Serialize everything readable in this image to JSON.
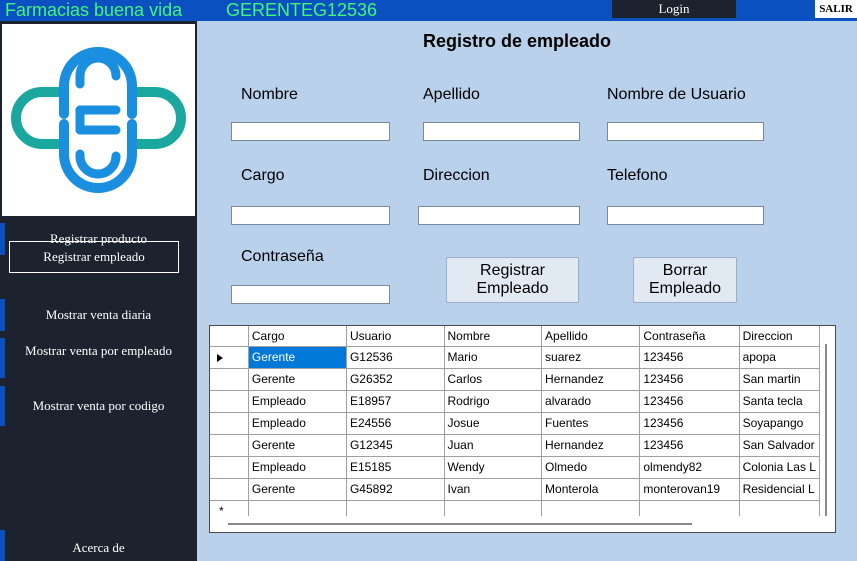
{
  "header": {
    "app_title": "Farmacias buena vida",
    "user_code": "GERENTEG12536",
    "login_label": "Login",
    "exit_label": "SALIR"
  },
  "sidebar": {
    "items": [
      {
        "label": "Registrar producto"
      },
      {
        "label": "Registrar empleado"
      },
      {
        "label": "Mostrar venta diaria"
      },
      {
        "label": "Mostrar venta por empleado"
      },
      {
        "label": "Mostrar venta por codigo"
      },
      {
        "label": "Acerca de"
      }
    ],
    "colors": {
      "logo_blue": "#1a8fe0",
      "logo_teal": "#1aa7a0"
    }
  },
  "form": {
    "title": "Registro de empleado",
    "labels": {
      "nombre": "Nombre",
      "apellido": "Apellido",
      "usuario": "Nombre de Usuario",
      "cargo": "Cargo",
      "direccion": "Direccion",
      "telefono": "Telefono",
      "contrasena": "Contraseña"
    },
    "values": {
      "nombre": "",
      "apellido": "",
      "usuario": "",
      "cargo": "",
      "direccion": "",
      "telefono": "",
      "contrasena": ""
    },
    "register_btn": {
      "line1": "Registrar",
      "line2": "Empleado"
    },
    "delete_btn": {
      "line1": "Borrar",
      "line2": "Empleado"
    }
  },
  "grid": {
    "columns": [
      "Cargo",
      "Usuario",
      "Nombre",
      "Apellido",
      "Contraseña",
      "Direccion"
    ],
    "rows": [
      [
        "Gerente",
        "G12536",
        "Mario",
        "suarez",
        "123456",
        "apopa"
      ],
      [
        "Gerente",
        "G26352",
        "Carlos",
        "Hernandez",
        "123456",
        "San martin"
      ],
      [
        "Empleado",
        "E18957",
        "Rodrigo",
        "alvarado",
        "123456",
        "Santa tecla"
      ],
      [
        "Empleado",
        "E24556",
        "Josue",
        "Fuentes",
        "123456",
        "Soyapango"
      ],
      [
        "Gerente",
        "G12345",
        "Juan",
        "Hernandez",
        "123456",
        "San Salvador"
      ],
      [
        "Empleado",
        "E15185",
        "Wendy",
        "Olmedo",
        "olmendy82",
        "Colonia Las L"
      ],
      [
        "Gerente",
        "G45892",
        "Ivan",
        "Monterola",
        "monterovan19",
        "Residencial L"
      ]
    ],
    "new_row_marker": "*",
    "selected_color": "#0078d7"
  }
}
